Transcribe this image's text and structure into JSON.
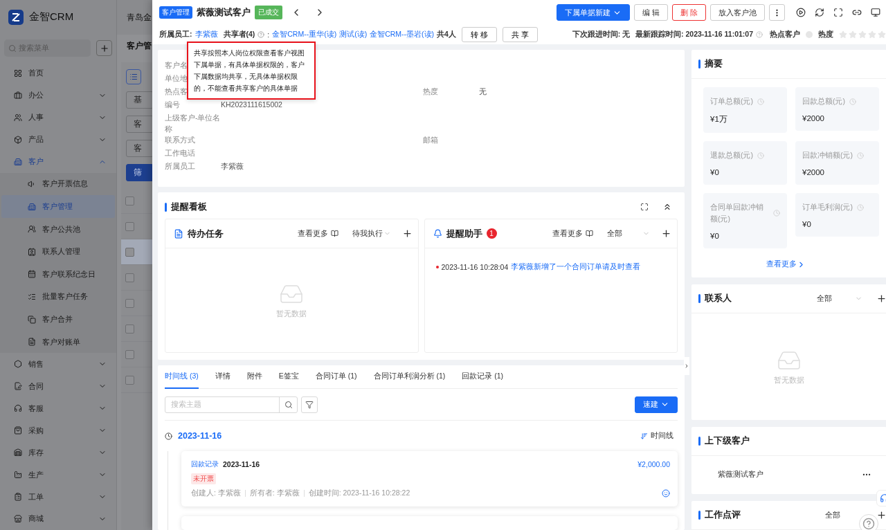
{
  "sidebar": {
    "logo": "金智CRM",
    "search_placeholder": "搜索菜单",
    "items": [
      {
        "label": "首页",
        "kind": "link",
        "selected": false
      },
      {
        "label": "办公",
        "kind": "group",
        "expanded": false
      },
      {
        "label": "人事",
        "kind": "group",
        "expanded": false
      },
      {
        "label": "产品",
        "kind": "group",
        "expanded": false
      },
      {
        "label": "客户",
        "kind": "group",
        "expanded": true,
        "children": [
          {
            "label": "客户开票信息",
            "selected": false
          },
          {
            "label": "客户管理",
            "selected": true
          },
          {
            "label": "客户公共池",
            "selected": false
          },
          {
            "label": "联系人管理",
            "selected": false
          },
          {
            "label": "客户联系纪念日",
            "selected": false
          },
          {
            "label": "批量客户任务",
            "selected": false
          },
          {
            "label": "客户合并",
            "selected": false
          },
          {
            "label": "客户对账单",
            "selected": false
          }
        ]
      },
      {
        "label": "销售",
        "kind": "group",
        "expanded": false
      },
      {
        "label": "合同",
        "kind": "group",
        "expanded": false
      },
      {
        "label": "客服",
        "kind": "group",
        "expanded": false
      },
      {
        "label": "采购",
        "kind": "group",
        "expanded": false
      },
      {
        "label": "库存",
        "kind": "group",
        "expanded": false
      },
      {
        "label": "生产",
        "kind": "group",
        "expanded": false
      },
      {
        "label": "工单",
        "kind": "group",
        "expanded": false
      },
      {
        "label": "商城",
        "kind": "group",
        "expanded": false
      }
    ]
  },
  "background_page": {
    "header_title": "青岛金",
    "breadcrumb": "客户管",
    "filter_buttons": [
      "基",
      "客",
      "客"
    ],
    "primary_button": "筛",
    "rows": [
      {
        "checked": false,
        "selected": false
      },
      {
        "checked": false,
        "selected": false
      },
      {
        "checked": false,
        "selected": true
      },
      {
        "checked": false,
        "selected": false
      },
      {
        "checked": false,
        "selected": false
      },
      {
        "checked": false,
        "selected": false
      },
      {
        "checked": false,
        "selected": false
      },
      {
        "checked": false,
        "selected": false
      }
    ]
  },
  "drawer": {
    "header": {
      "module_tag": "客户管理",
      "title": "紫薇测试客户",
      "status": "已成交",
      "actions": [
        {
          "label": "下属单据新建",
          "kind": "primary"
        },
        {
          "label": "编 辑",
          "kind": "default"
        },
        {
          "label": "删 除",
          "kind": "danger"
        },
        {
          "label": "放入客户池",
          "kind": "default"
        }
      ]
    },
    "owner": {
      "label": "所属员工:",
      "name": "李紫薇"
    },
    "sharers": {
      "label": "共享者(4)",
      "separator": ":",
      "items": [
        "金智CRM--重华(读)",
        "测试(读)",
        "金智CRM--墨岩(读)"
      ],
      "total": "共4人"
    },
    "share_actions": [
      "转 移",
      "共 享"
    ],
    "follow": {
      "next": "下次跟进时间: 无",
      "latest": "最新跟踪时间: 2023-11-16 11:01:07"
    },
    "hot_customer": {
      "label": "热点客户",
      "on": false
    },
    "heat": {
      "label": "热度",
      "stars": 0
    },
    "tooltip": "共享按照本人岗位权限查看客户视图下属单据，有具体单据权限的，客户下属数据均共享，无具体单据权限的，不能查看共享客户的具体单据",
    "info_rows": [
      {
        "cells": [
          {
            "label": "客户名"
          }
        ]
      },
      {
        "cells": [
          {
            "label": "单位地"
          }
        ]
      },
      {
        "cells": [
          {
            "label": "热点客"
          },
          {
            "label": "热度",
            "value": "无"
          }
        ]
      },
      {
        "cells": [
          {
            "label": "编号",
            "value": "KH2023111615002"
          }
        ]
      },
      {
        "cells": [
          {
            "label": "上级客户-单位名称"
          }
        ]
      },
      {
        "cells": [
          {
            "label": "联系方式"
          },
          {
            "label": "邮箱"
          }
        ]
      },
      {
        "cells": [
          {
            "label": "工作电话"
          }
        ]
      },
      {
        "cells": [
          {
            "label": "所属员工",
            "value": "李紫薇"
          }
        ]
      }
    ],
    "reminder_board": {
      "title": "提醒看板",
      "todo": {
        "title": "待办任务",
        "more": "查看更多",
        "filter": "待我执行",
        "empty": "暂无数据"
      },
      "assistant": {
        "title": "提醒助手",
        "badge": "1",
        "more": "查看更多",
        "filter": "全部",
        "items": [
          {
            "time": "2023-11-16 10:28:04",
            "text": "李紫薇新增了一个合同订单请及时查看"
          }
        ]
      }
    },
    "tabs": [
      {
        "label": "时间线 (3)",
        "selected": true
      },
      {
        "label": "详情",
        "selected": false
      },
      {
        "label": "附件",
        "selected": false
      },
      {
        "label": "E签宝",
        "selected": false
      },
      {
        "label": "合同订单 (1)",
        "selected": false
      },
      {
        "label": "合同订单利润分析 (1)",
        "selected": false
      },
      {
        "label": "回款记录 (1)",
        "selected": false
      }
    ],
    "search_placeholder": "搜索主题",
    "quick_create": "速建",
    "timeline": {
      "sort_label": "时间线",
      "groups": [
        {
          "date": "2023-11-16",
          "entries": [
            {
              "type": "回款记录",
              "date": "2023-11-16",
              "amount": "¥2,000.00",
              "tag": "未开票",
              "meta": [
                "创建人: 李紫薇",
                "所有者: 李紫薇",
                "创建时间: 2023-11-16 10:28:22"
              ]
            }
          ]
        }
      ]
    },
    "summary": {
      "title": "摘要",
      "stats": [
        {
          "label": "订单总额(元)",
          "value": "¥1万"
        },
        {
          "label": "回款总额(元)",
          "value": "¥2000"
        },
        {
          "label": "退款总额(元)",
          "value": "¥0"
        },
        {
          "label": "回款冲销额(元)",
          "value": "¥2000"
        },
        {
          "label": "合同单回款冲销额(元)",
          "value": "¥0"
        },
        {
          "label": "订单毛利润(元)",
          "value": "¥0"
        }
      ],
      "more": "查看更多"
    },
    "contacts": {
      "title": "联系人",
      "filter": "全部",
      "empty": "暂无数据"
    },
    "related": {
      "title": "上下级客户",
      "items": [
        "紫薇测试客户"
      ]
    },
    "review": {
      "title": "工作点评",
      "filter": "全部"
    }
  }
}
